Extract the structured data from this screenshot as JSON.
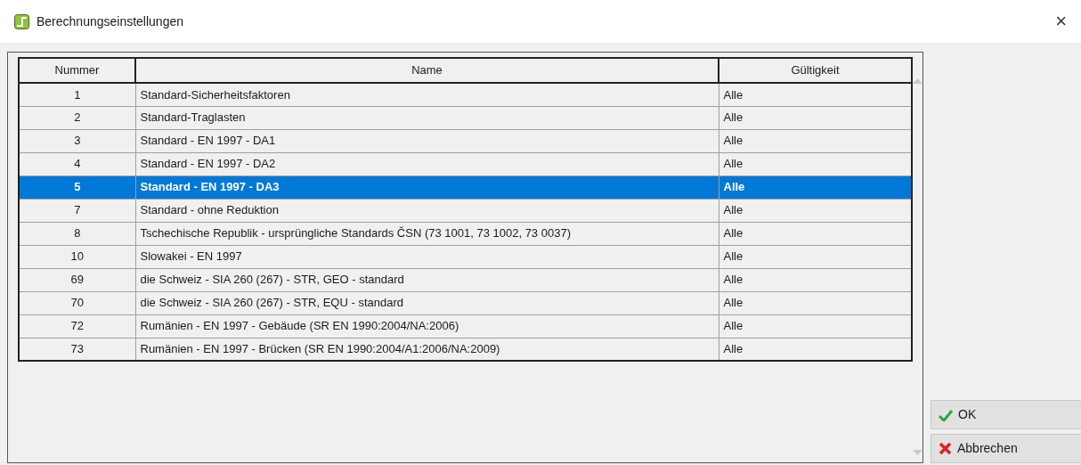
{
  "window": {
    "title": "Berechnungseinstellungen",
    "close": "×"
  },
  "table": {
    "columns": [
      "Nummer",
      "Name",
      "Gültigkeit"
    ],
    "rows": [
      {
        "number": "1",
        "name": "Standard-Sicherheitsfaktoren",
        "validity": "Alle",
        "selected": false
      },
      {
        "number": "2",
        "name": "Standard-Traglasten",
        "validity": "Alle",
        "selected": false
      },
      {
        "number": "3",
        "name": "Standard - EN 1997 - DA1",
        "validity": "Alle",
        "selected": false
      },
      {
        "number": "4",
        "name": "Standard - EN 1997 - DA2",
        "validity": "Alle",
        "selected": false
      },
      {
        "number": "5",
        "name": "Standard - EN 1997 - DA3",
        "validity": "Alle",
        "selected": true
      },
      {
        "number": "7",
        "name": "Standard - ohne Reduktion",
        "validity": "Alle",
        "selected": false
      },
      {
        "number": "8",
        "name": "Tschechische Republik - ursprüngliche Standards ČSN (73 1001, 73 1002, 73 0037)",
        "validity": "Alle",
        "selected": false
      },
      {
        "number": "10",
        "name": "Slowakei - EN 1997",
        "validity": "Alle",
        "selected": false
      },
      {
        "number": "69",
        "name": "die Schweiz - SIA 260 (267) - STR, GEO - standard",
        "validity": "Alle",
        "selected": false
      },
      {
        "number": "70",
        "name": "die Schweiz - SIA 260 (267) - STR, EQU - standard",
        "validity": "Alle",
        "selected": false
      },
      {
        "number": "72",
        "name": "Rumänien - EN 1997 - Gebäude (SR EN 1990:2004/NA:2006)",
        "validity": "Alle",
        "selected": false
      },
      {
        "number": "73",
        "name": "Rumänien - EN 1997 - Brücken (SR EN 1990:2004/A1:2006/NA:2009)",
        "validity": "Alle",
        "selected": false
      }
    ]
  },
  "buttons": [
    {
      "kind": "ok",
      "label": "OK"
    },
    {
      "kind": "cancel",
      "label": "Abbrechen"
    }
  ]
}
